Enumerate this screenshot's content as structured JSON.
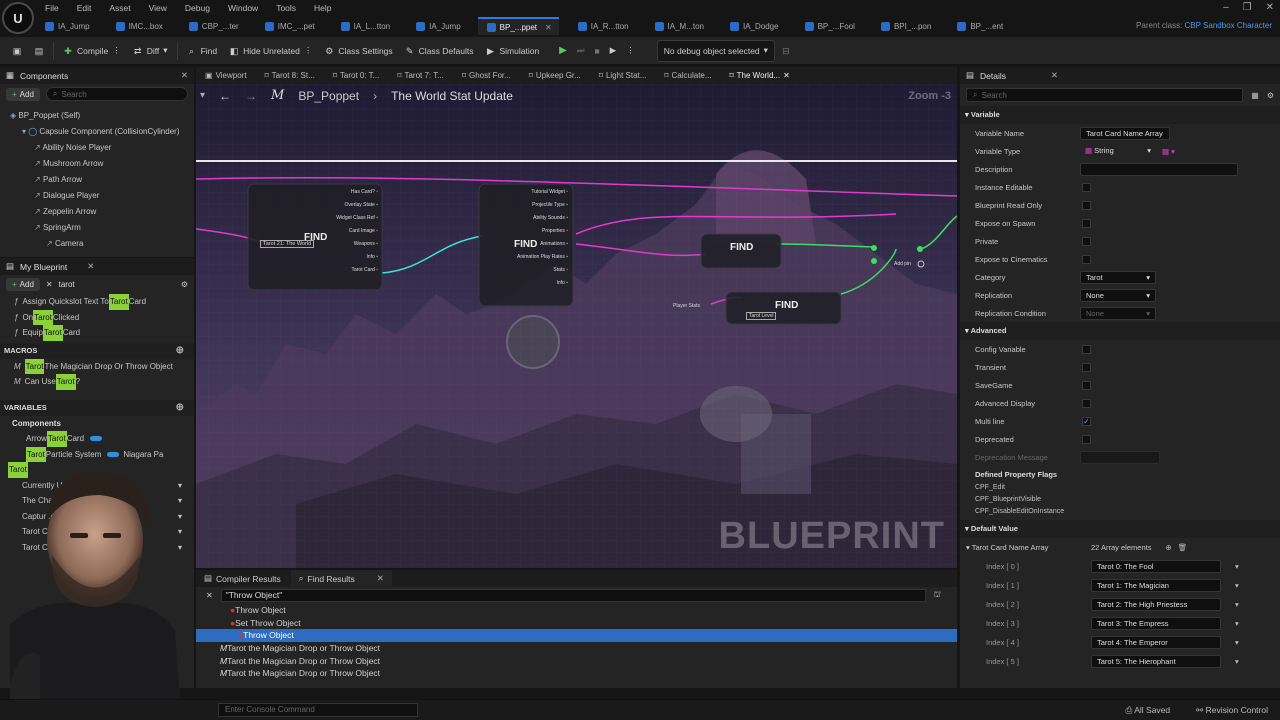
{
  "menu": [
    "File",
    "Edit",
    "Asset",
    "View",
    "Debug",
    "Window",
    "Tools",
    "Help"
  ],
  "tabs": [
    {
      "label": "IA_Jump",
      "active": false
    },
    {
      "label": "IMC...box",
      "active": false
    },
    {
      "label": "CBP_...ter",
      "active": false
    },
    {
      "label": "IMC_...pet",
      "active": false
    },
    {
      "label": "IA_L...tton",
      "active": false
    },
    {
      "label": "IA_Jump",
      "active": false
    },
    {
      "label": "BP_...ppet",
      "active": true
    },
    {
      "label": "IA_R...tton",
      "active": false
    },
    {
      "label": "IA_M...ton",
      "active": false
    },
    {
      "label": "IA_Dodge",
      "active": false
    },
    {
      "label": "BP_...Fool",
      "active": false
    },
    {
      "label": "BPI_...pon",
      "active": false
    },
    {
      "label": "BP_...ent",
      "active": false
    }
  ],
  "parent_class": {
    "label": "Parent class:",
    "value": "CBP Sandbox Character"
  },
  "toolbar": {
    "compile": "Compile",
    "diff": "Diff",
    "find": "Find",
    "hide_unrelated": "Hide Unrelated",
    "class_settings": "Class Settings",
    "class_defaults": "Class Defaults",
    "simulation": "Simulation",
    "debug_object": "No debug object selected"
  },
  "components": {
    "title": "Components",
    "add": "Add",
    "search_placeholder": "Search",
    "items": [
      {
        "label": "BP_Poppet (Self)",
        "indent": 0
      },
      {
        "label": "Capsule Component (CollisionCylinder)",
        "indent": 1
      },
      {
        "label": "Ability Noise Player",
        "indent": 2
      },
      {
        "label": "Mushroom Arrow",
        "indent": 2
      },
      {
        "label": "Path Arrow",
        "indent": 2
      },
      {
        "label": "Dialogue Player",
        "indent": 2
      },
      {
        "label": "Zeppelin Arrow",
        "indent": 2
      },
      {
        "label": "SpringArm",
        "indent": 2
      },
      {
        "label": "Camera",
        "indent": 3
      }
    ]
  },
  "my_blueprint": {
    "title": "My Blueprint",
    "add": "Add",
    "search_value": "tarot",
    "functions": [
      {
        "pre": "Assign Quickslot Text To ",
        "hl": "Tarot",
        "post": " Card"
      },
      {
        "pre": "On ",
        "hl": "Tarot",
        "post": " Clicked"
      },
      {
        "pre": "Equip ",
        "hl": "Tarot",
        "post": " Card"
      }
    ],
    "macros_header": "MACROS",
    "macros": [
      {
        "pre": "",
        "hl": "Tarot",
        "post": " The Magician Drop Or Throw Object"
      },
      {
        "pre": "Can Use ",
        "hl": "Tarot",
        "post": "?"
      }
    ],
    "variables_header": "VARIABLES",
    "var_components_header": "Components",
    "var_components": [
      {
        "pre": "Arrow ",
        "hl": "Tarot",
        "post": " Card",
        "color": "#2f8fe0"
      },
      {
        "pre": "",
        "hl": "Tarot",
        "post": " Particle System",
        "color": "#2f8fe0",
        "type": "Niagara Pa"
      }
    ],
    "var_tarot_header": "Tarot",
    "var_tarot": [
      {
        "label": "Currently Used Tarot"
      },
      {
        "label": "The Chariot"
      },
      {
        "label": "Captured Object"
      },
      {
        "label": "Tarot Card"
      },
      {
        "label": "Tarot Card Array"
      }
    ]
  },
  "graph_tabs": [
    "Viewport",
    "Tarot 8: St...",
    "Tarot 0: T...",
    "Tarot 7: T...",
    "Ghost For...",
    "Upkeep Gr...",
    "Light Stat...",
    "Calculate...",
    "The World..."
  ],
  "breadcrumb": {
    "bp": "BP_Poppet",
    "graph": "The World Stat Update",
    "zoom": "Zoom -3"
  },
  "watermark": "BLUEPRINT",
  "nodes": {
    "find1_pins": [
      "Has Card?",
      "Overlay State",
      "Widget Class Ref",
      "Card Image",
      "Weapons",
      "Info",
      "Tarot Card"
    ],
    "find1_label": "Tarot 21: The World",
    "find2_pins": [
      "Tutorial Widget",
      "Projectile Type",
      "Ability Sounds",
      "Properties",
      "Animations",
      "Animation Play Rates",
      "Stats",
      "Info"
    ],
    "find_label": "FIND",
    "add_pin": "Add pin",
    "player_stats": "Player Stats",
    "tarot_level": "Tarot Level"
  },
  "bottom": {
    "tabs": [
      "Compiler Results",
      "Find Results"
    ],
    "query": "\"Throw Object\"",
    "results": [
      {
        "label": "Throw Object",
        "indent": 1,
        "selected": false
      },
      {
        "label": "Set Throw Object",
        "indent": 1,
        "selected": false
      },
      {
        "label": "Throw Object",
        "indent": 2,
        "selected": true
      },
      {
        "label": "Tarot the Magician Drop or Throw Object",
        "indent": 0,
        "selected": false
      },
      {
        "label": "Tarot the Magician Drop or Throw Object",
        "indent": 0,
        "selected": false
      },
      {
        "label": "Tarot the Magician Drop or Throw Object",
        "indent": 0,
        "selected": false
      }
    ]
  },
  "details": {
    "title": "Details",
    "search_placeholder": "Search",
    "variable_header": "Variable",
    "rows": [
      {
        "label": "Variable Name",
        "kind": "text",
        "value": "Tarot Card Name Array"
      },
      {
        "label": "Variable Type",
        "kind": "type",
        "value": "String"
      },
      {
        "label": "Description",
        "kind": "text",
        "value": ""
      },
      {
        "label": "Instance Editable",
        "kind": "check",
        "value": ""
      },
      {
        "label": "Blueprint Read Only",
        "kind": "check",
        "value": ""
      },
      {
        "label": "Expose on Spawn",
        "kind": "check",
        "value": ""
      },
      {
        "label": "Private",
        "kind": "check",
        "value": ""
      },
      {
        "label": "Expose to Cinematics",
        "kind": "check",
        "value": ""
      },
      {
        "label": "Category",
        "kind": "drop",
        "value": "Tarot"
      },
      {
        "label": "Replication",
        "kind": "drop",
        "value": "None"
      },
      {
        "label": "Replication Condition",
        "kind": "dropdim",
        "value": "None"
      }
    ],
    "advanced_header": "Advanced",
    "adv_rows": [
      {
        "label": "Config Variable",
        "kind": "check",
        "value": ""
      },
      {
        "label": "Transient",
        "kind": "check",
        "value": ""
      },
      {
        "label": "SaveGame",
        "kind": "check",
        "value": ""
      },
      {
        "label": "Advanced Display",
        "kind": "check",
        "value": ""
      },
      {
        "label": "Multi line",
        "kind": "checked",
        "value": ""
      },
      {
        "label": "Deprecated",
        "kind": "check",
        "value": ""
      },
      {
        "label": "Deprecation Message",
        "kind": "dim",
        "value": ""
      }
    ],
    "flags_header": "Defined Property Flags",
    "flags": [
      "CPF_Edit",
      "CPF_BlueprintVisible",
      "CPF_DisableEditOnInstance"
    ],
    "default_header": "Default Value",
    "array_label": "Tarot Card Name Array",
    "array_count": "22 Array elements",
    "elements": [
      {
        "index": "Index [ 0 ]",
        "value": "Tarot 0: The Fool"
      },
      {
        "index": "Index [ 1 ]",
        "value": "Tarot 1: The Magician"
      },
      {
        "index": "Index [ 2 ]",
        "value": "Tarot 2: The High Priestess"
      },
      {
        "index": "Index [ 3 ]",
        "value": "Tarot 3: The Empress"
      },
      {
        "index": "Index [ 4 ]",
        "value": "Tarot 4: The Emperor"
      },
      {
        "index": "Index [ 5 ]",
        "value": "Tarot 5: The Hierophant"
      }
    ]
  },
  "status": {
    "console_placeholder": "Enter Console Command",
    "all_saved": "All Saved",
    "revision": "Revision Control"
  }
}
